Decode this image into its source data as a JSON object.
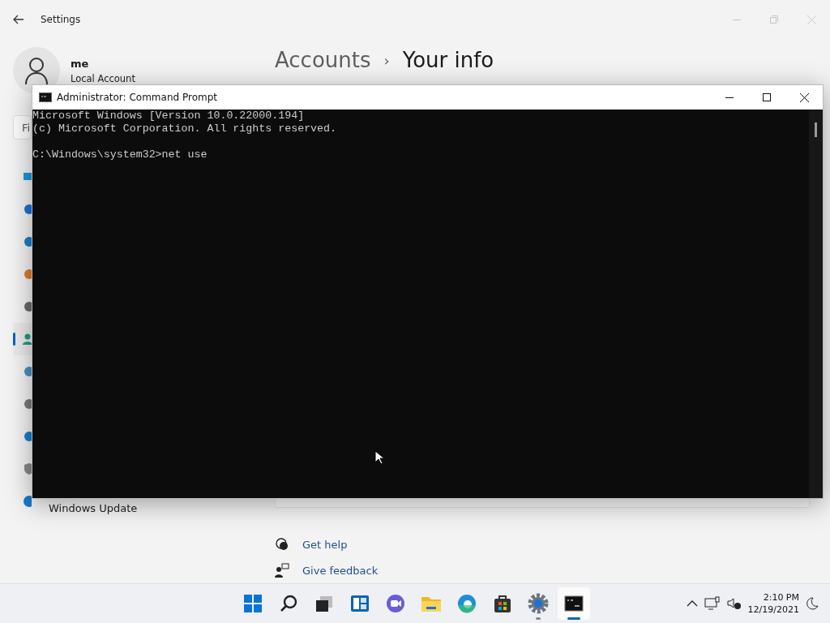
{
  "settings_window": {
    "title": "Settings",
    "user": {
      "name": "me",
      "account_type": "Local Account"
    },
    "breadcrumb": {
      "parent": "Accounts",
      "separator": "›",
      "current": "Your info"
    },
    "search": {
      "value": "Fi"
    },
    "sidebar": {
      "items": [
        {
          "selected": false
        },
        {
          "selected": false
        },
        {
          "selected": false
        },
        {
          "selected": false
        },
        {
          "selected": false
        },
        {
          "selected": true
        },
        {
          "selected": false
        },
        {
          "selected": false
        },
        {
          "selected": false
        },
        {
          "selected": false
        },
        {
          "label": "Windows Update",
          "selected": false
        }
      ]
    },
    "links": [
      {
        "label": "Get help",
        "kind": "help"
      },
      {
        "label": "Give feedback",
        "kind": "feedback"
      }
    ]
  },
  "cmd_window": {
    "title": "Administrator: Command Prompt",
    "lines": [
      {
        "text": "Microsoft Windows [Version 10.0.22000.194]",
        "blank_before": false
      },
      {
        "text": "(c) Microsoft Corporation. All rights reserved.",
        "blank_before": false
      },
      {
        "text": "C:\\Windows\\system32>net use",
        "blank_before": true
      }
    ]
  },
  "taskbar": {
    "apps": [
      {
        "running": false,
        "active": false
      },
      {
        "running": false,
        "active": false
      },
      {
        "running": false,
        "active": false
      },
      {
        "running": false,
        "active": false
      },
      {
        "running": false,
        "active": false
      },
      {
        "running": false,
        "active": false
      },
      {
        "running": false,
        "active": false
      },
      {
        "running": false,
        "active": false
      },
      {
        "running": true,
        "active": false
      },
      {
        "running": true,
        "active": true
      }
    ],
    "clock": {
      "time": "2:10 PM",
      "date": "12/19/2021"
    }
  }
}
